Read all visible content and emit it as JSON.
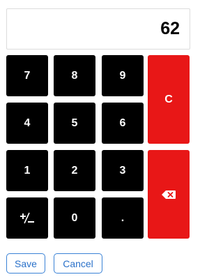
{
  "display": {
    "value": "62"
  },
  "keypad": {
    "digits": {
      "k7": "7",
      "k8": "8",
      "k9": "9",
      "k4": "4",
      "k5": "5",
      "k6": "6",
      "k1": "1",
      "k2": "2",
      "k3": "3",
      "k0": "0",
      "decimal": "."
    },
    "clear_label": "C",
    "plus_minus_icon": "plus-minus-icon",
    "backspace_icon": "backspace-icon"
  },
  "actions": {
    "save_label": "Save",
    "cancel_label": "Cancel"
  },
  "colors": {
    "key_bg": "#000000",
    "key_text": "#ffffff",
    "danger": "#e81717",
    "link_blue": "#2a71c9"
  }
}
